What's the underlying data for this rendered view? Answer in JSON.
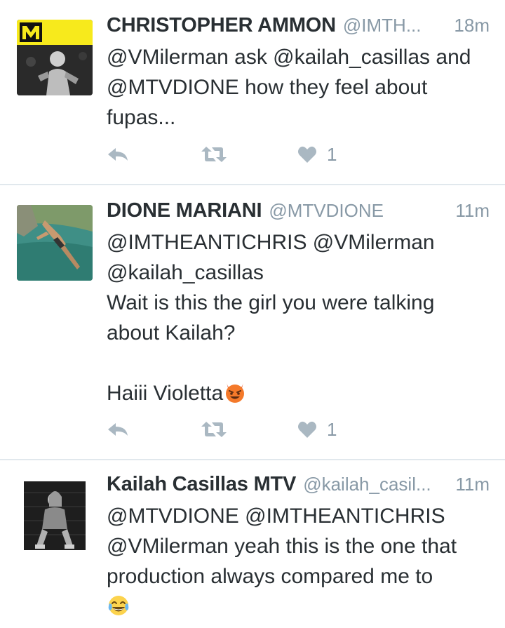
{
  "tweets": [
    {
      "name": "CHRISTOPHER AMMON",
      "handle": "@IMTH...",
      "time": "18m",
      "text": "@VMilerman ask @kailah_casillas and\n@MTVDIONE how they feel about\nfupas...",
      "likes": "1",
      "avatar_logo": "MTV"
    },
    {
      "name": "DIONE MARIANI",
      "handle": "@MTVDIONE",
      "time": "11m",
      "text": "@IMTHEANTICHRIS @VMilerman\n@kailah_casillas\nWait is this the girl you were talking\nabout Kailah?\n\nHaiii Violetta",
      "emoji": "smiling-devil-emoji",
      "likes": "1"
    },
    {
      "name": "Kailah Casillas MTV",
      "handle": "@kailah_casil...",
      "time": "11m",
      "text": "@MTVDIONE @IMTHEANTICHRIS\n@VMilerman yeah this is the one that\nproduction always compared me to",
      "emoji": "tears-of-joy-emoji"
    }
  ],
  "icons": {
    "reply": "reply-icon",
    "retweet": "retweet-icon",
    "like": "heart-icon"
  },
  "colors": {
    "name": "#292f33",
    "secondary": "#8899a6",
    "divider": "#e1e8ed",
    "action_icon": "#aab8c2"
  }
}
